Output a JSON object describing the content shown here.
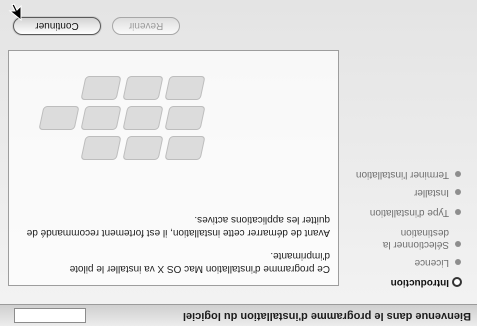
{
  "window": {
    "title": "Bienvenue dans le programme d'installation du logiciel"
  },
  "sidebar": {
    "steps": [
      {
        "label": "Introduction",
        "active": true
      },
      {
        "label": "Licence",
        "active": false
      },
      {
        "label": "Sélectionner la destination",
        "active": false
      },
      {
        "label": "Type d'installation",
        "active": false
      },
      {
        "label": "Installer",
        "active": false
      },
      {
        "label": "Terminer l'installation",
        "active": false
      }
    ]
  },
  "content": {
    "paragraph1": "Ce programme d'installation Mac OS X va installer le pilote d'imprimante.",
    "paragraph2": "Avant de démarrer cette installation, il est fortement recommandé de quitter les applications actives."
  },
  "buttons": {
    "back": "Revenir",
    "continue": "Continuer"
  },
  "colors": {
    "chrome": "#cfcfcf",
    "text": "#1b1b1b",
    "muted": "#8e8e8e"
  }
}
